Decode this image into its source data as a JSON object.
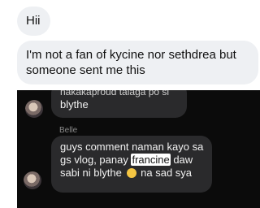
{
  "messages": {
    "greeting": "Hii",
    "main": "I'm not a fan of kycine nor sethdrea but someone sent me this"
  },
  "screenshot": {
    "previous_cut_text": "nakakaproud talaga po si",
    "previous_text": "blythe",
    "sender_name": "Belle",
    "reply_line1": "guys comment naman kayo sa",
    "reply_line2_pre": "gs vlog, panay ",
    "reply_line2_highlight": "francine",
    "reply_line2_post": " daw",
    "reply_line3_pre": "sabi ni blythe",
    "reply_line3_post": "na sad sya",
    "emoji_icon": "sad-face-emoji"
  }
}
